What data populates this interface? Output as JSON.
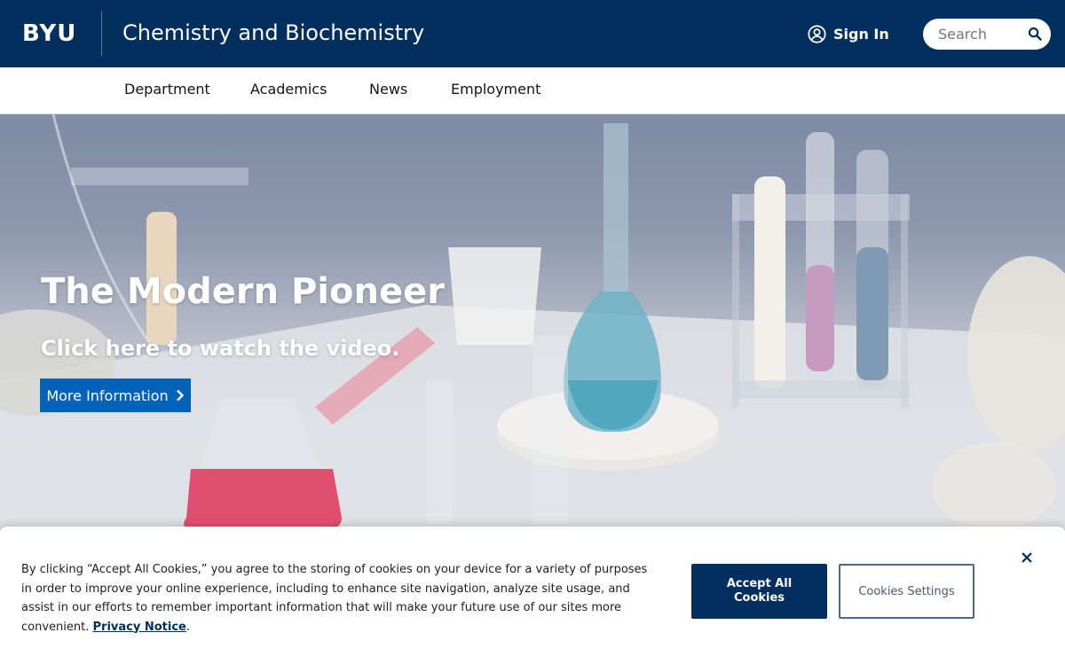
{
  "header": {
    "logo": "BYU",
    "site_title": "Chemistry and Biochemistry",
    "sign_in_label": "Sign In",
    "search_placeholder": "Search",
    "bg_color": "#002e5d"
  },
  "nav": {
    "items": [
      {
        "label": "Department"
      },
      {
        "label": "Academics"
      },
      {
        "label": "News"
      },
      {
        "label": "Employment"
      }
    ]
  },
  "hero": {
    "title": "The Modern Pioneer",
    "subtitle": "Click here to watch the video.",
    "button_label": "More Information",
    "button_color": "#0062b8"
  },
  "cookie_banner": {
    "text": "By clicking “Accept All Cookies,” you agree to the storing of cookies on your device for a variety of purposes in order to improve your online experience, including to enhance site navigation, analyze site usage, and assist in our efforts to remember important information that will make your future use of our sites more convenient.",
    "privacy_link": "Privacy Notice",
    "accept_label": "Accept All Cookies",
    "settings_label": "Cookies Settings"
  },
  "icons": {
    "user": "user-circle-icon",
    "search": "search-icon",
    "chevron": "chevron-right-icon",
    "close": "close-icon"
  }
}
